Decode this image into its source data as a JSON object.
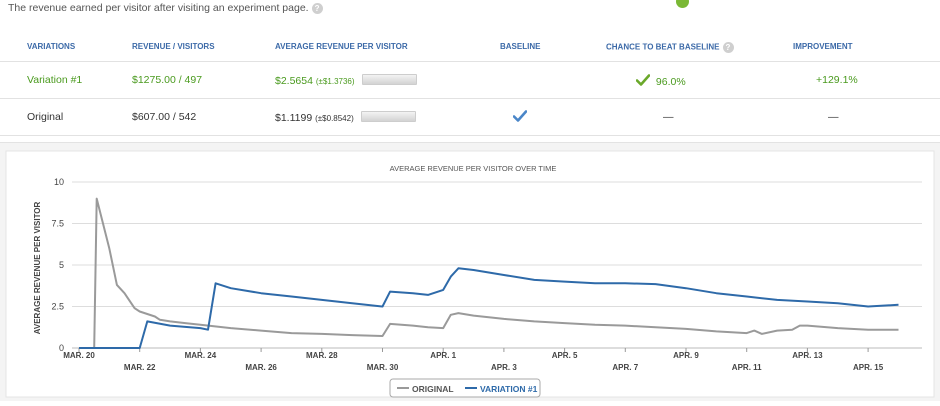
{
  "description": "The revenue earned per visitor after visiting an experiment page.",
  "colors": {
    "green": "#7ab835",
    "header_blue": "#3c6aa8",
    "series_original": "#9a9a9a",
    "series_variation": "#2e6aa9"
  },
  "table": {
    "headers": [
      "VARIATIONS",
      "REVENUE / VISITORS",
      "AVERAGE REVENUE PER VISITOR",
      "BASELINE",
      "CHANCE TO BEAT BASELINE",
      "IMPROVEMENT"
    ],
    "rows": [
      {
        "name": "Variation #1",
        "revenue_visitors": "$1275.00 / 497",
        "avg": "$2.5654",
        "avg_err": "(±$1.3736)",
        "baseline": "",
        "chance": "96.0%",
        "improvement": "+129.1%"
      },
      {
        "name": "Original",
        "revenue_visitors": "$607.00 / 542",
        "avg": "$1.1199",
        "avg_err": "(±$0.8542)",
        "baseline": "checkmark-icon",
        "chance": "—",
        "improvement": "—"
      }
    ]
  },
  "chart_data": {
    "type": "line",
    "title": "AVERAGE REVENUE PER VISITOR OVER TIME",
    "ylabel": "AVERAGE REVENUE PER VISITOR",
    "xlabel": "",
    "ylim": [
      0,
      10
    ],
    "yticks": [
      "0",
      "2.5",
      "5",
      "7.5",
      "10"
    ],
    "xlim": [
      "2013-03-20",
      "2013-04-16"
    ],
    "xticks": [
      "MAR. 20",
      "MAR. 22",
      "MAR. 24",
      "MAR. 26",
      "MAR. 28",
      "MAR. 30",
      "APR. 1",
      "APR. 3",
      "APR. 5",
      "APR. 7",
      "APR. 9",
      "APR. 11",
      "APR. 13",
      "APR. 15"
    ],
    "grid": true,
    "legend": "bottom-center",
    "series": [
      {
        "name": "ORIGINAL",
        "x": [
          "2013-03-20T00:00",
          "2013-03-20T12:00",
          "2013-03-20T14:00",
          "2013-03-21T00:00",
          "2013-03-21T06:00",
          "2013-03-21T12:00",
          "2013-03-21T20:00",
          "2013-03-22T00:00",
          "2013-03-22T12:00",
          "2013-03-22T16:00",
          "2013-03-23T00:00",
          "2013-03-23T12:00",
          "2013-03-24T00:00",
          "2013-03-25T00:00",
          "2013-03-26T00:00",
          "2013-03-27T00:00",
          "2013-03-28T00:00",
          "2013-03-29T00:00",
          "2013-03-30T00:00",
          "2013-03-30T06:00",
          "2013-03-31T00:00",
          "2013-03-31T12:00",
          "2013-04-01T00:00",
          "2013-04-01T06:00",
          "2013-04-01T12:00",
          "2013-04-02T00:00",
          "2013-04-03T00:00",
          "2013-04-04T00:00",
          "2013-04-05T00:00",
          "2013-04-06T00:00",
          "2013-04-07T00:00",
          "2013-04-08T00:00",
          "2013-04-09T00:00",
          "2013-04-10T00:00",
          "2013-04-11T00:00",
          "2013-04-11T06:00",
          "2013-04-11T12:00",
          "2013-04-12T00:00",
          "2013-04-12T12:00",
          "2013-04-12T18:00",
          "2013-04-13T00:00",
          "2013-04-14T00:00",
          "2013-04-15T00:00",
          "2013-04-16T00:00"
        ],
        "y": [
          0,
          0,
          9.0,
          6.0,
          3.8,
          3.3,
          2.4,
          2.2,
          1.9,
          1.7,
          1.6,
          1.5,
          1.4,
          1.2,
          1.05,
          0.9,
          0.85,
          0.78,
          0.72,
          1.45,
          1.35,
          1.25,
          1.2,
          2.0,
          2.1,
          1.95,
          1.75,
          1.6,
          1.5,
          1.4,
          1.35,
          1.25,
          1.15,
          1.0,
          0.9,
          1.05,
          0.85,
          1.05,
          1.1,
          1.35,
          1.35,
          1.2,
          1.1,
          1.1
        ]
      },
      {
        "name": "VARIATION #1",
        "x": [
          "2013-03-20T00:00",
          "2013-03-22T00:00",
          "2013-03-22T06:00",
          "2013-03-23T00:00",
          "2013-03-24T00:00",
          "2013-03-24T06:00",
          "2013-03-24T12:00",
          "2013-03-25T00:00",
          "2013-03-26T00:00",
          "2013-03-27T00:00",
          "2013-03-28T00:00",
          "2013-03-29T00:00",
          "2013-03-30T00:00",
          "2013-03-30T06:00",
          "2013-03-31T00:00",
          "2013-03-31T12:00",
          "2013-04-01T00:00",
          "2013-04-01T06:00",
          "2013-04-01T12:00",
          "2013-04-02T00:00",
          "2013-04-03T00:00",
          "2013-04-04T00:00",
          "2013-04-05T00:00",
          "2013-04-06T00:00",
          "2013-04-07T00:00",
          "2013-04-08T00:00",
          "2013-04-09T00:00",
          "2013-04-10T00:00",
          "2013-04-11T00:00",
          "2013-04-12T00:00",
          "2013-04-13T00:00",
          "2013-04-14T00:00",
          "2013-04-15T00:00",
          "2013-04-16T00:00"
        ],
        "y": [
          0,
          0,
          1.6,
          1.35,
          1.2,
          1.1,
          3.9,
          3.6,
          3.3,
          3.1,
          2.9,
          2.7,
          2.5,
          3.4,
          3.3,
          3.2,
          3.5,
          4.3,
          4.8,
          4.7,
          4.4,
          4.1,
          4.0,
          3.9,
          3.9,
          3.85,
          3.6,
          3.3,
          3.1,
          2.9,
          2.8,
          2.7,
          2.5,
          2.6
        ]
      }
    ]
  }
}
